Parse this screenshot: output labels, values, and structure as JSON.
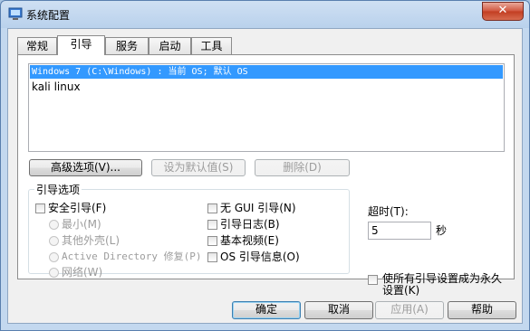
{
  "window": {
    "title": "系统配置",
    "close_label": "✕"
  },
  "tabs": [
    "常规",
    "引导",
    "服务",
    "启动",
    "工具"
  ],
  "boot_entries": [
    "Windows 7 (C:\\Windows) : 当前 OS; 默认 OS",
    "kali linux"
  ],
  "buttons": {
    "advanced": "高级选项(V)...",
    "set_default": "设为默认值(S)",
    "delete": "删除(D)"
  },
  "boot_options": {
    "group_title": "引导选项",
    "safe_boot": "安全引导(F)",
    "minimal": "最小(M)",
    "alternate_shell": "其他外壳(L)",
    "active_directory": "Active Directory 修复(P)",
    "network": "网络(W)",
    "no_gui": "无 GUI 引导(N)",
    "boot_log": "引导日志(B)",
    "base_video": "基本视频(E)",
    "os_boot_info": "OS 引导信息(O)"
  },
  "timeout": {
    "label": "超时(T):",
    "value": "5",
    "unit": "秒"
  },
  "make_permanent": "使所有引导设置成为永久设置(K)",
  "footer": {
    "ok": "确定",
    "cancel": "取消",
    "apply": "应用(A)",
    "help": "帮助"
  }
}
